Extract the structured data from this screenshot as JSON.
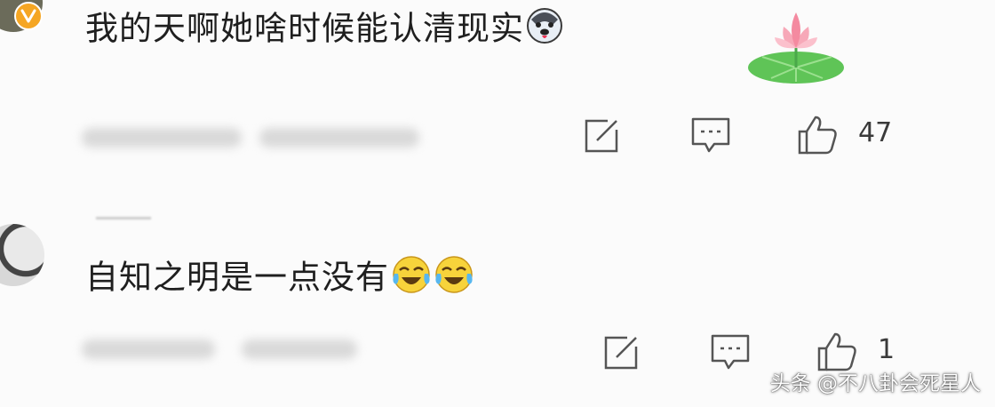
{
  "comments": [
    {
      "text": "我的天啊她啥时候能认清现实",
      "emoji": [
        "husky-face-emoji"
      ],
      "like_count": "47"
    },
    {
      "text": "自知之明是一点没有",
      "emoji": [
        "laughing-tears-emoji",
        "laughing-tears-emoji"
      ],
      "like_count": "1"
    }
  ],
  "watermark": "头条 @不八卦会死星人",
  "colors": {
    "badge": "#f5a623",
    "icon_stroke": "#555555",
    "background": "#fbfbfb"
  },
  "icons": [
    "share-icon",
    "comment-icon",
    "like-icon",
    "lotus-sticker"
  ]
}
